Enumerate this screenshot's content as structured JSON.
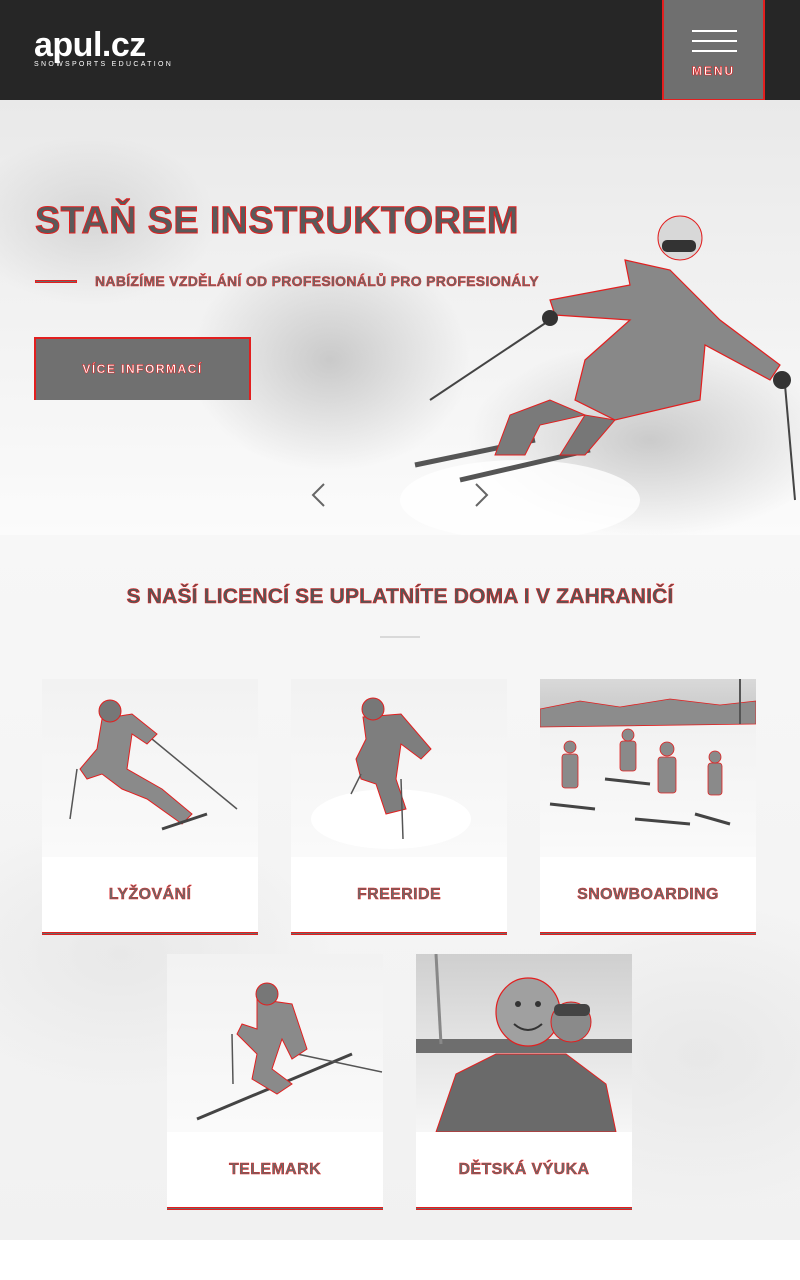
{
  "header": {
    "logo_main": "apul.cz",
    "logo_sub": "SNOWSPORTS EDUCATION",
    "menu_label": "MENU"
  },
  "hero": {
    "title": "STAŇ SE INSTRUKTOREM",
    "subtitle": "NABÍZÍME VZDĚLÁNÍ OD PROFESIONÁLŮ PRO PROFESIONÁLY",
    "button_label": "VÍCE INFORMACÍ"
  },
  "section": {
    "title": "S NAŠÍ LICENCÍ SE UPLATNÍTE DOMA I V ZAHRANIČÍ"
  },
  "cards": [
    {
      "label": "LYŽOVÁNÍ",
      "icon": "skiing-photo"
    },
    {
      "label": "FREERIDE",
      "icon": "freeride-photo"
    },
    {
      "label": "SNOWBOARDING",
      "icon": "snowboarding-photo"
    },
    {
      "label": "TELEMARK",
      "icon": "telemark-photo"
    },
    {
      "label": "DĚTSKÁ VÝUKA",
      "icon": "kids-teaching-photo"
    }
  ],
  "colors": {
    "header_bg": "#262626",
    "accent": "#e21f1f",
    "button_bg": "#707070"
  }
}
